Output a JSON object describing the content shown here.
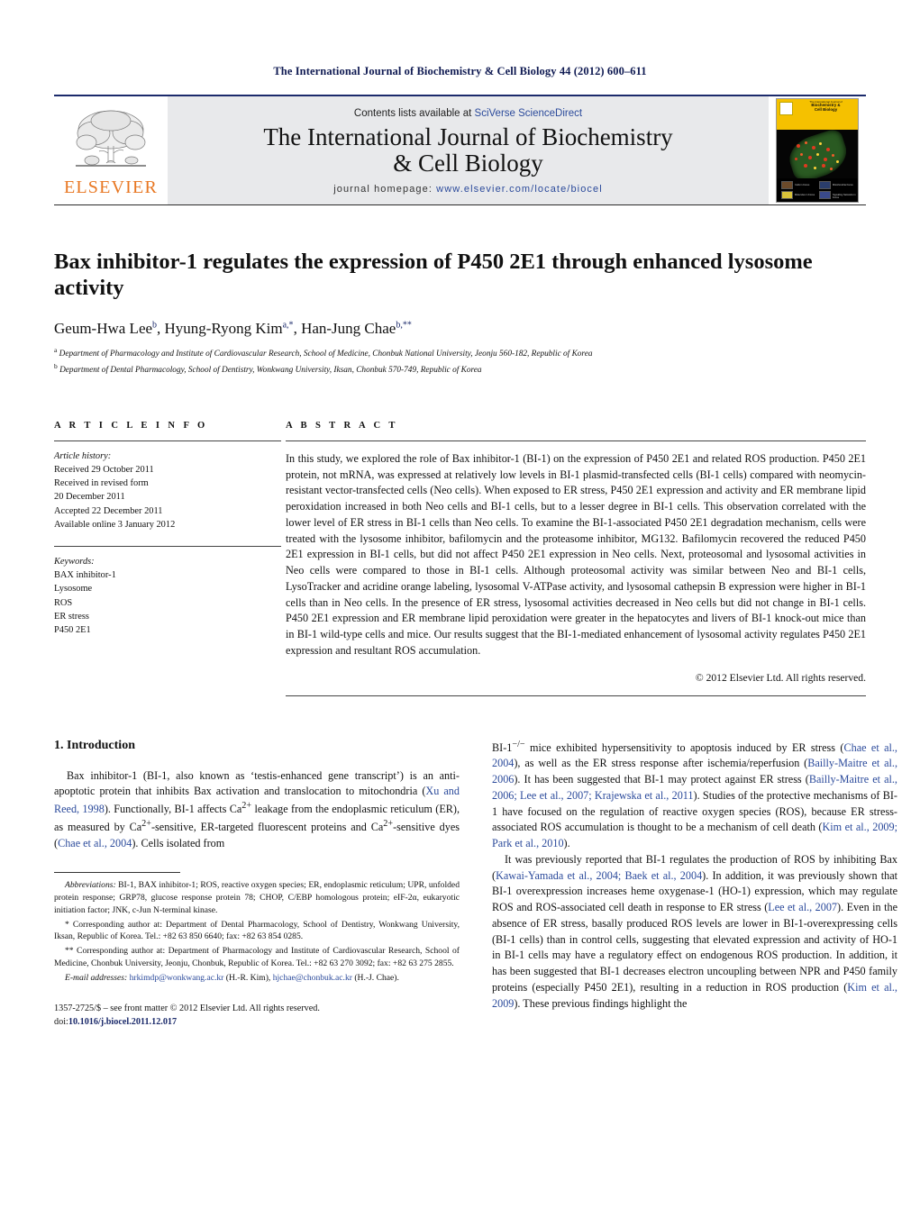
{
  "running_head": "The International Journal of Biochemistry & Cell Biology 44 (2012) 600–611",
  "masthead": {
    "contents_prefix": "Contents lists available at ",
    "contents_link": "SciVerse ScienceDirect",
    "journal_title_line1": "The International Journal of Biochemistry",
    "journal_title_line2": "& Cell Biology",
    "homepage_label": "journal homepage:",
    "homepage_url": "www.elsevier.com/locate/biocel",
    "publisher_logo_text": "ELSEVIER",
    "publisher_logo_icon": "elsevier-tree-icon",
    "cover": {
      "band_small_title": "The International Journal of",
      "band_title_line1": "Biochemistry &",
      "band_title_line2": "Cell Biology",
      "tile_labels": [
        "Cells in Focus",
        "Mitochondria Focus",
        "Molecules in Focus",
        "Signalling Networks in Focus"
      ]
    }
  },
  "article": {
    "title": "Bax inhibitor-1 regulates the expression of P450 2E1 through enhanced lysosome activity",
    "authors": [
      {
        "name": "Geum-Hwa Lee",
        "sup": "b"
      },
      {
        "name": "Hyung-Ryong Kim",
        "sup": "a,*"
      },
      {
        "name": "Han-Jung Chae",
        "sup": "b,**"
      }
    ],
    "affiliations": [
      {
        "marker": "a",
        "text": "Department of Pharmacology and Institute of Cardiovascular Research, School of Medicine, Chonbuk National University, Jeonju 560-182, Republic of Korea"
      },
      {
        "marker": "b",
        "text": "Department of Dental Pharmacology, School of Dentistry, Wonkwang University, Iksan, Chonbuk 570-749, Republic of Korea"
      }
    ]
  },
  "article_info": {
    "heading": "A R T I C L E  I N F O",
    "history_label": "Article history:",
    "history": [
      "Received 29 October 2011",
      "Received in revised form",
      "20 December 2011",
      "Accepted 22 December 2011",
      "Available online 3 January 2012"
    ],
    "keywords_label": "Keywords:",
    "keywords": [
      "BAX inhibitor-1",
      "Lysosome",
      "ROS",
      "ER stress",
      "P450 2E1"
    ]
  },
  "abstract": {
    "heading": "A B S T R A C T",
    "text": "In this study, we explored the role of Bax inhibitor-1 (BI-1) on the expression of P450 2E1 and related ROS production. P450 2E1 protein, not mRNA, was expressed at relatively low levels in BI-1 plasmid-transfected cells (BI-1 cells) compared with neomycin-resistant vector-transfected cells (Neo cells). When exposed to ER stress, P450 2E1 expression and activity and ER membrane lipid peroxidation increased in both Neo cells and BI-1 cells, but to a lesser degree in BI-1 cells. This observation correlated with the lower level of ER stress in BI-1 cells than Neo cells. To examine the BI-1-associated P450 2E1 degradation mechanism, cells were treated with the lysosome inhibitor, bafilomycin and the proteasome inhibitor, MG132. Bafilomycin recovered the reduced P450 2E1 expression in BI-1 cells, but did not affect P450 2E1 expression in Neo cells. Next, proteosomal and lysosomal activities in Neo cells were compared to those in BI-1 cells. Although proteosomal activity was similar between Neo and BI-1 cells, LysoTracker and acridine orange labeling, lysosomal V-ATPase activity, and lysosomal cathepsin B expression were higher in BI-1 cells than in Neo cells. In the presence of ER stress, lysosomal activities decreased in Neo cells but did not change in BI-1 cells. P450 2E1 expression and ER membrane lipid peroxidation were greater in the hepatocytes and livers of BI-1 knock-out mice than in BI-1 wild-type cells and mice. Our results suggest that the BI-1-mediated enhancement of lysosomal activity regulates P450 2E1 expression and resultant ROS accumulation.",
    "copyright": "© 2012 Elsevier Ltd. All rights reserved."
  },
  "body": {
    "section_heading": "1. Introduction",
    "left_paragraph_1": [
      {
        "t": "Bax inhibitor-1 (BI-1, also known as ‘testis-enhanced gene transcript’) is an anti-apoptotic protein that inhibits Bax activation and translocation to mitochondria ("
      },
      {
        "t": "Xu and Reed, 1998",
        "cite": true
      },
      {
        "t": "). Functionally, BI-1 affects Ca"
      },
      {
        "t": "2+",
        "sup": true
      },
      {
        "t": " leakage from the endoplasmic reticulum (ER), as measured by Ca"
      },
      {
        "t": "2+",
        "sup": true
      },
      {
        "t": "-sensitive, ER-targeted fluorescent proteins and Ca"
      },
      {
        "t": "2+",
        "sup": true
      },
      {
        "t": "-sensitive dyes ("
      },
      {
        "t": "Chae et al., 2004",
        "cite": true
      },
      {
        "t": "). Cells isolated from"
      }
    ],
    "right_paragraph_1": [
      {
        "t": "BI-1"
      },
      {
        "t": "−/−",
        "sup": true
      },
      {
        "t": " mice exhibited hypersensitivity to apoptosis induced by ER stress ("
      },
      {
        "t": "Chae et al., 2004",
        "cite": true
      },
      {
        "t": "), as well as the ER stress response after ischemia/reperfusion ("
      },
      {
        "t": "Bailly-Maitre et al., 2006",
        "cite": true
      },
      {
        "t": "). It has been suggested that BI-1 may protect against ER stress ("
      },
      {
        "t": "Bailly-Maitre et al., 2006; Lee et al., 2007; Krajewska et al., 2011",
        "cite": true
      },
      {
        "t": "). Studies of the protective mechanisms of BI-1 have focused on the regulation of reactive oxygen species (ROS), because ER stress-associated ROS accumulation is thought to be a mechanism of cell death ("
      },
      {
        "t": "Kim et al., 2009; Park et al., 2010",
        "cite": true
      },
      {
        "t": ")."
      }
    ],
    "right_paragraph_2": [
      {
        "t": "It was previously reported that BI-1 regulates the production of ROS by inhibiting Bax ("
      },
      {
        "t": "Kawai-Yamada et al., 2004; Baek et al., 2004",
        "cite": true
      },
      {
        "t": "). In addition, it was previously shown that BI-1 overexpression increases heme oxygenase-1 (HO-1) expression, which may regulate ROS and ROS-associated cell death in response to ER stress ("
      },
      {
        "t": "Lee et al., 2007",
        "cite": true
      },
      {
        "t": "). Even in the absence of ER stress, basally produced ROS levels are lower in BI-1-overexpressing cells (BI-1 cells) than in control cells, suggesting that elevated expression and activity of HO-1 in BI-1 cells may have a regulatory effect on endogenous ROS production. In addition, it has been suggested that BI-1 decreases electron uncoupling between NPR and P450 family proteins (especially P450 2E1), resulting in a reduction in ROS production ("
      },
      {
        "t": "Kim et al., 2009",
        "cite": true
      },
      {
        "t": "). These previous findings highlight the"
      }
    ]
  },
  "footnotes": {
    "abbreviations_label": "Abbreviations:",
    "abbreviations_text": " BI-1, BAX inhibitor-1; ROS, reactive oxygen species; ER, endoplasmic reticulum; UPR, unfolded protein response; GRP78, glucose response protein 78; CHOP, C/EBP homologous protein; eIF-2α, eukaryotic initiation factor; JNK, c-Jun N-terminal kinase.",
    "corresponding_1": "* Corresponding author at: Department of Dental Pharmacology, School of Dentistry, Wonkwang University, Iksan, Republic of Korea. Tel.: +82 63 850 6640; fax: +82 63 854 0285.",
    "corresponding_2": "** Corresponding author at: Department of Pharmacology and Institute of Cardiovascular Research, School of Medicine, Chonbuk University, Jeonju, Chonbuk, Republic of Korea. Tel.: +82 63 270 3092; fax: +82 63 275 2855.",
    "email_label": "E-mail addresses:",
    "email_1": "hrkimdp@wonkwang.ac.kr",
    "email_1_owner": " (H.-R. Kim), ",
    "email_2": "hjchae@chonbuk.ac.kr",
    "email_2_owner": " (H.-J. Chae)."
  },
  "imprint": {
    "issn_line": "1357-2725/$ – see front matter © 2012 Elsevier Ltd. All rights reserved.",
    "doi_prefix": "doi:",
    "doi": "10.1016/j.biocel.2011.12.017"
  }
}
